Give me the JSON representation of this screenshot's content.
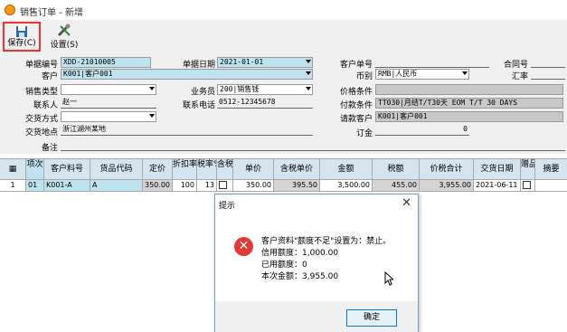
{
  "window": {
    "title": "销售订单 - 新增"
  },
  "toolbar": {
    "save_label": "保存(C)",
    "settings_label": "设置(S)"
  },
  "form": {
    "doc_no_label": "单据编号",
    "doc_no": "XDD-21010005",
    "doc_date_label": "单据日期",
    "doc_date": "2021-01-01",
    "customer_label": "客户",
    "customer": "K001|客户001",
    "sales_type_label": "销售类型",
    "sales_type": "",
    "salesman_label": "业务员",
    "salesman": "200|销售钱",
    "contact_label": "联系人",
    "contact": "赵一",
    "phone_label": "联系电话",
    "phone": "0512-12345678",
    "trade_mode_label": "交货方式",
    "trade_mode": "",
    "delivery_place_label": "交货地点",
    "delivery_place": "浙江湖州某地",
    "remark_label": "备注",
    "remark": "",
    "cust_no_label": "客户单号",
    "cust_no": "",
    "contract_no_label": "合同号",
    "contract_no": "",
    "currency_label": "币别",
    "currency": "RMB|人民币",
    "exchange_label": "汇率",
    "exchange": "",
    "price_cond_label": "价格条件",
    "price_cond": "",
    "pay_cond_label": "付款条件",
    "pay_cond": "TT030|月结T/T30天 EOM T/T 30 DAYS",
    "bill_cust_label": "请款客户",
    "bill_cust": "K001|客户001",
    "deposit_label": "订金",
    "deposit": "0"
  },
  "grid": {
    "headers": [
      "项次",
      "客户料号",
      "货品代码",
      "定价",
      "折扣率%",
      "税率%",
      "含税",
      "单价",
      "含税单价",
      "金额",
      "税额",
      "价税合计",
      "交货日期",
      "赠品",
      "摘要"
    ],
    "row": [
      "1",
      "01",
      "K001-A",
      "A",
      "350.00",
      "100",
      "13",
      "",
      "350.00",
      "395.50",
      "3,500.00",
      "455.00",
      "3,955.00",
      "2021-06-11",
      "",
      ""
    ]
  },
  "dialog": {
    "title": "提示",
    "line1": "客户资料\"额度不足\"设置为：禁止。",
    "line2": "信用额度：1,000.00",
    "line3": "已用额度：0",
    "line4": "本次金额：3,955.00",
    "ok_label": "确定"
  }
}
